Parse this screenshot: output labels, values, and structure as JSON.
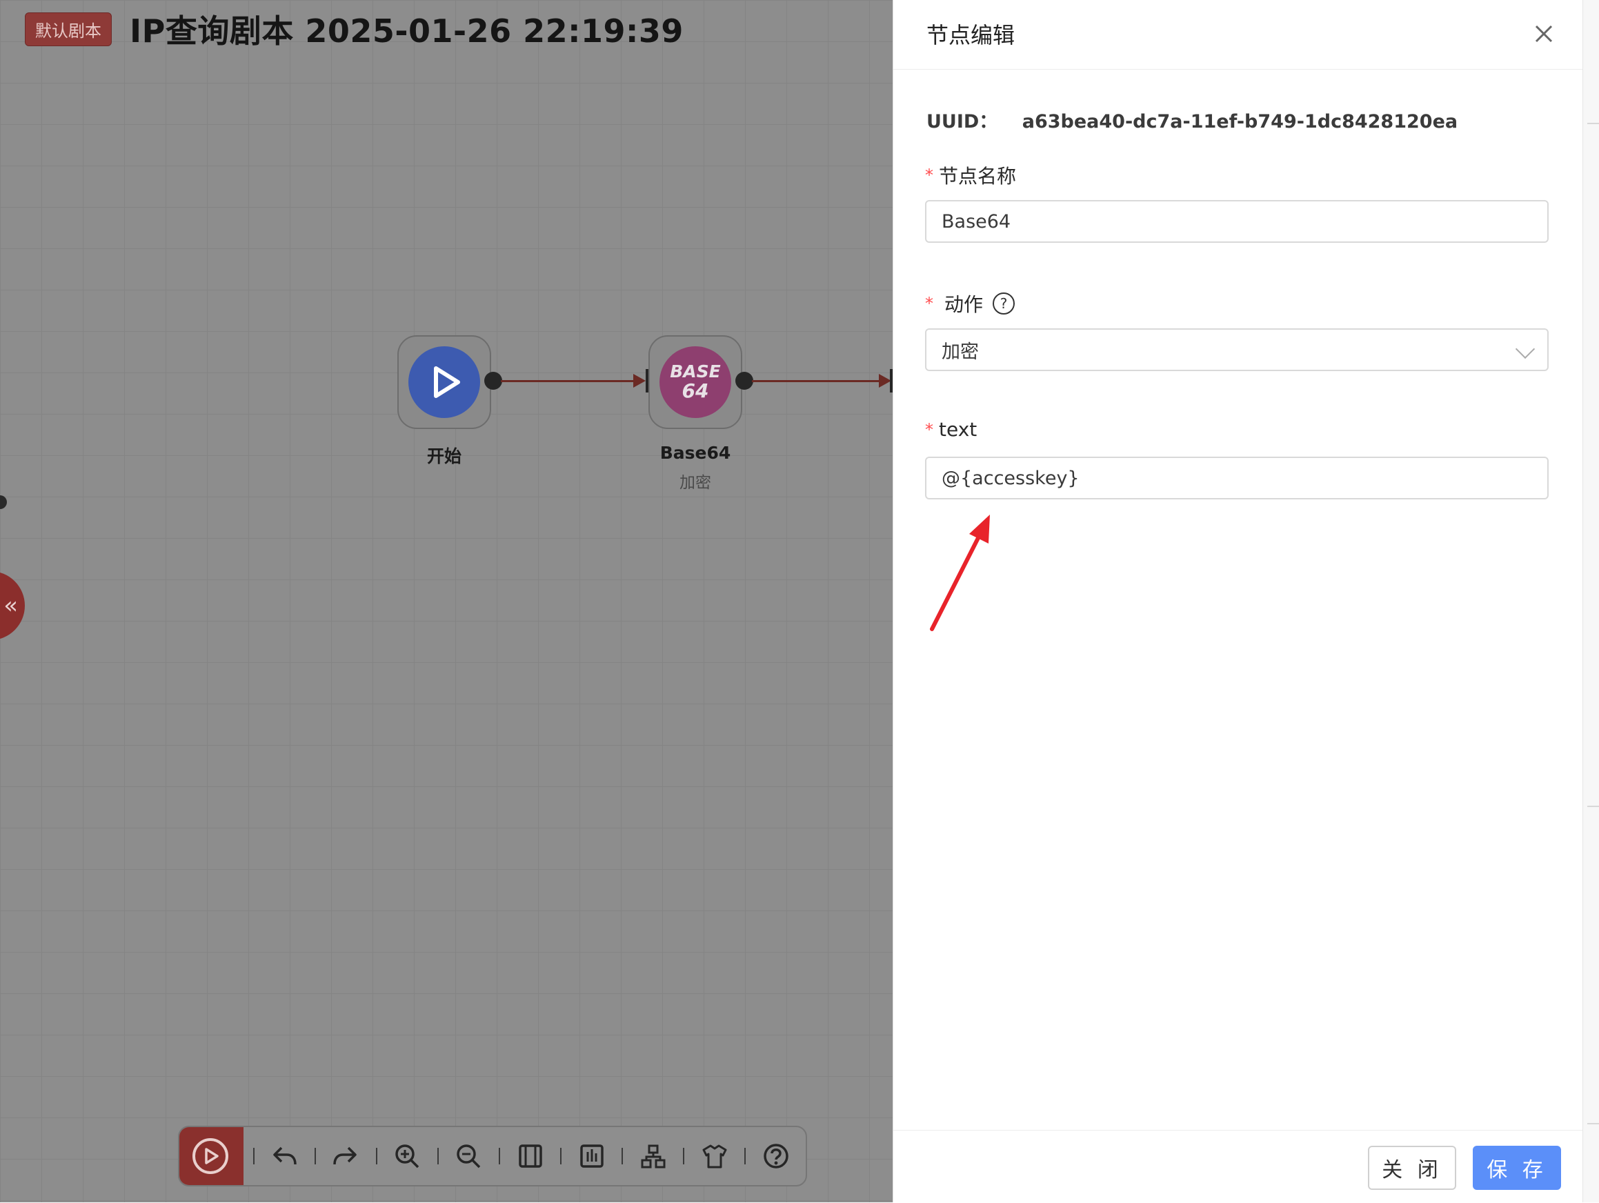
{
  "header": {
    "tag": "默认剧本",
    "title": "IP查询剧本 2025-01-26 22:19:39"
  },
  "flow": {
    "nodes": [
      {
        "label": "开始",
        "icon": "play-icon",
        "color": "#3d5bb0"
      },
      {
        "label": "Base64",
        "sub": "加密",
        "icon_text_1": "BASE",
        "icon_text_2": "64",
        "color": "#8e3f6f"
      }
    ]
  },
  "sidebar_toggle": {
    "glyph": "«"
  },
  "toolbar": {
    "items": [
      "run-icon",
      "undo-icon",
      "redo-icon",
      "zoom-in-icon",
      "zoom-out-icon",
      "fit-view-icon",
      "center-icon",
      "layout-icon",
      "theme-icon",
      "help-icon"
    ]
  },
  "drawer": {
    "title": "节点编辑",
    "uuid_label": "UUID：",
    "uuid_value": "a63bea40-dc7a-11ef-b749-1dc8428120ea",
    "fields": {
      "name": {
        "label": "节点名称",
        "value": "Base64"
      },
      "action": {
        "label": "动作",
        "value": "加密"
      },
      "text": {
        "label": "text",
        "value": "@{accesskey}"
      }
    },
    "buttons": {
      "close": "关 闭",
      "save": "保 存"
    },
    "colors": {
      "primary": "#5b8ff9",
      "required": "#ff4d4f",
      "annotation": "#e8232a"
    }
  }
}
